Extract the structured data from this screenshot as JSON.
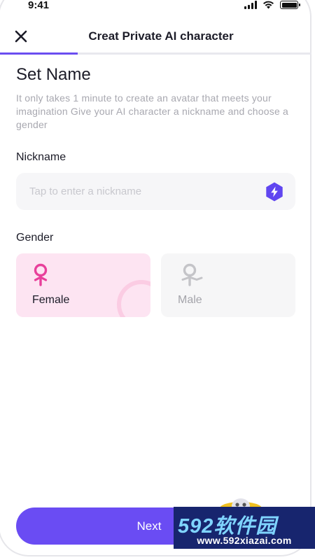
{
  "status_bar": {
    "time": "9:41"
  },
  "header": {
    "title": "Creat Private AI character"
  },
  "progress": {
    "value": 0.25,
    "color": "#6b4ef0"
  },
  "content": {
    "title": "Set Name",
    "description": "It only takes 1 minute to create an avatar that meets your imagination Give your AI character a nickname and choose a gender"
  },
  "nickname": {
    "label": "Nickname",
    "placeholder": "Tap to enter a nickname",
    "value": "",
    "random_icon": "lightning-hexagon-icon"
  },
  "gender": {
    "label": "Gender",
    "options": [
      {
        "label": "Female",
        "icon": "female-symbol-icon",
        "selected": true,
        "color": "#e8409b"
      },
      {
        "label": "Male",
        "icon": "male-symbol-icon",
        "selected": false,
        "color": "#c4c4c8"
      }
    ]
  },
  "next_button": {
    "label": "Next",
    "color": "#6a4cf3"
  },
  "watermark": {
    "logo_text": "592软件园",
    "url": "www.592xiazai.com"
  }
}
